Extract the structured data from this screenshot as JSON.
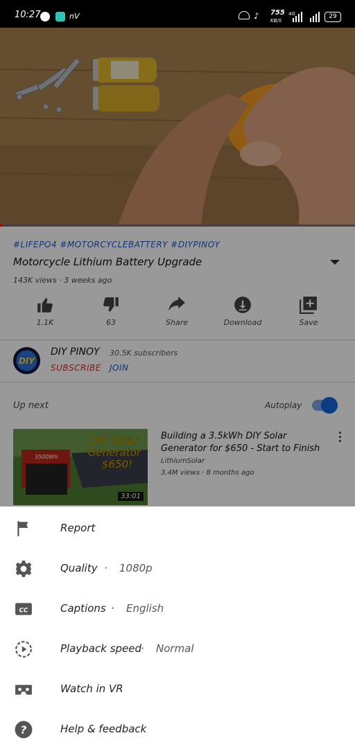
{
  "status_bar": {
    "time": "10:27",
    "app_badge": "nV",
    "net_speed_value": "755",
    "net_speed_unit": "KB/S",
    "network_type": "4G",
    "battery": "29",
    "icons": [
      "messenger-icon",
      "app-icon",
      "vpn-icon",
      "mute-icon",
      "signal-icon",
      "battery-icon"
    ]
  },
  "video": {
    "hashtags": "#LIFEPO4 #MOTORCYCLEBATTERY #DIYPINOY",
    "title": "Motorcycle Lithium Battery Upgrade",
    "meta": "143K views · 3 weeks ago",
    "progress": 0.005,
    "actions": [
      {
        "icon": "thumbs-up-icon",
        "label": "1.1K"
      },
      {
        "icon": "thumbs-down-icon",
        "label": "63"
      },
      {
        "icon": "share-icon",
        "label": "Share"
      },
      {
        "icon": "download-icon",
        "label": "Download"
      },
      {
        "icon": "save-playlist-icon",
        "label": "Save"
      }
    ]
  },
  "channel": {
    "name": "DIY PINOY",
    "subscribers": "30.5K subscribers",
    "subscribe_label": "SUBSCRIBE",
    "join_label": "JOIN",
    "avatar_text": "DIY"
  },
  "up_next": {
    "label": "Up next",
    "autoplay_label": "Autoplay",
    "autoplay_on": true,
    "item": {
      "title": "Building a 3.5kWh DIY Solar Generator for $650 - Start to Finish",
      "channel": "LithiumSolar",
      "meta": "3.4M views · 8 months ago",
      "duration": "33:01",
      "thumb_line1": "DIY Solar",
      "thumb_line2": "Generator",
      "thumb_line3": "$650!",
      "thumb_label": "3500Wh"
    }
  },
  "menu": {
    "items": [
      {
        "icon": "flag-icon",
        "label": "Report",
        "value": ""
      },
      {
        "icon": "gear-icon",
        "label": "Quality",
        "value": "1080p"
      },
      {
        "icon": "captions-icon",
        "label": "Captions",
        "value": "English"
      },
      {
        "icon": "playback-speed-icon",
        "label": "Playback speed",
        "value": "Normal"
      },
      {
        "icon": "vr-headset-icon",
        "label": "Watch in VR",
        "value": ""
      },
      {
        "icon": "help-icon",
        "label": "Help & feedback",
        "value": ""
      }
    ]
  },
  "colors": {
    "accent_blue": "#1565d8",
    "hashtag_blue": "#1a56c9",
    "subscribe_red": "#c4302b",
    "progress_red": "#ee0000",
    "scrim": "rgba(0,0,0,0.40)"
  }
}
